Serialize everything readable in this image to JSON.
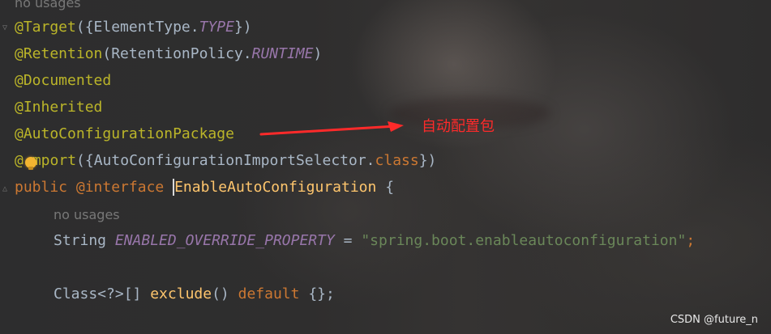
{
  "editor": {
    "hint_top": "no usages",
    "line_target": {
      "at": "@Target",
      "open": "({",
      "cls": "ElementType",
      "dot": ".",
      "const": "TYPE",
      "close": "})"
    },
    "line_retention": {
      "at": "@Retention",
      "open": "(",
      "cls": "RetentionPolicy",
      "dot": ".",
      "const": "RUNTIME",
      "close": ")"
    },
    "line_documented": "@Documented",
    "line_inherited": "@Inherited",
    "line_autoconfigpkg": "@AutoConfigurationPackage",
    "line_import": {
      "at_a": "@",
      "at_b": "mport",
      "open": "({",
      "cls": "AutoConfigurationImportSelector",
      "dot": ".",
      "kw": "class",
      "close": "})"
    },
    "line_decl": {
      "kw_public": "public",
      "kw_interface": "@interface",
      "name": "EnableAutoConfiguration",
      "brace": "{"
    },
    "hint_field": "no usages",
    "line_field": {
      "type": "String",
      "name": "ENABLED_OVERRIDE_PROPERTY",
      "eq": "=",
      "value": "\"spring.boot.enableautoconfiguration\"",
      "semi": ";"
    },
    "line_method": {
      "type": "Class<?>[]",
      "name": "exclude",
      "parens": "()",
      "kw": "default",
      "value": "{};"
    }
  },
  "annotation": {
    "label": "自动配置包",
    "color": "#ff2a2a"
  },
  "watermark": "CSDN @future_n",
  "colors": {
    "annotation": "#bbb529",
    "keyword": "#cc7832",
    "constant": "#9876aa",
    "string": "#6a8759",
    "method": "#ffc66d",
    "text": "#a9b7c6"
  },
  "icons": [
    "fold-marker-icon",
    "intention-bulb-icon",
    "arrow-icon"
  ]
}
